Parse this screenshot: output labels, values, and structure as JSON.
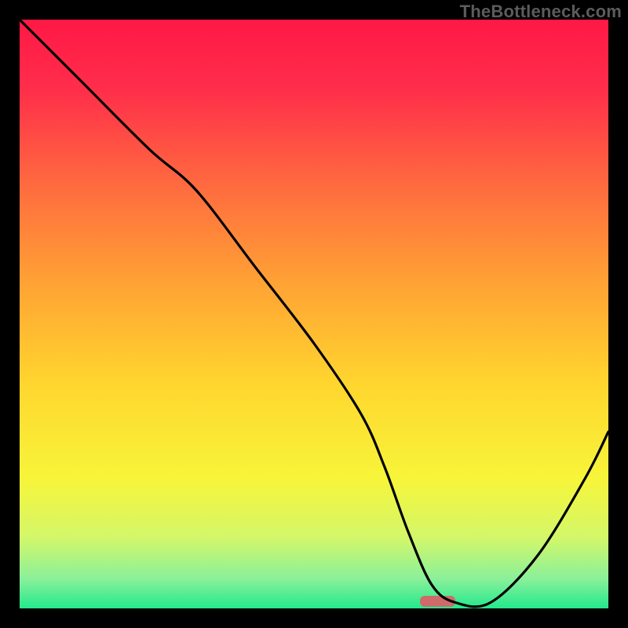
{
  "watermark": "TheBottleneck.com",
  "colors": {
    "frame": "#000000",
    "curve": "#000000",
    "marker": "#d06a6a",
    "gradient_stops": [
      {
        "offset": 0.0,
        "color": "#ff1846"
      },
      {
        "offset": 0.12,
        "color": "#ff2e4a"
      },
      {
        "offset": 0.28,
        "color": "#ff6a3f"
      },
      {
        "offset": 0.45,
        "color": "#ffa334"
      },
      {
        "offset": 0.62,
        "color": "#ffd62e"
      },
      {
        "offset": 0.78,
        "color": "#f7f53a"
      },
      {
        "offset": 0.88,
        "color": "#d3f76a"
      },
      {
        "offset": 0.95,
        "color": "#8af09a"
      },
      {
        "offset": 1.0,
        "color": "#23e98c"
      }
    ]
  },
  "chart_data": {
    "type": "line",
    "title": "",
    "xlabel": "",
    "ylabel": "",
    "xlim": [
      0,
      100
    ],
    "ylim": [
      0,
      100
    ],
    "grid": false,
    "legend": false,
    "series": [
      {
        "name": "bottleneck-curve",
        "x": [
          0,
          10,
          22,
          30,
          40,
          50,
          58,
          62,
          66,
          70,
          74,
          80,
          88,
          96,
          100
        ],
        "values": [
          100,
          90,
          78,
          71,
          58,
          45,
          33,
          24,
          13,
          4,
          1,
          1,
          9,
          22,
          30
        ]
      }
    ],
    "marker": {
      "x_center": 71,
      "width": 6,
      "y": 0.5
    }
  }
}
